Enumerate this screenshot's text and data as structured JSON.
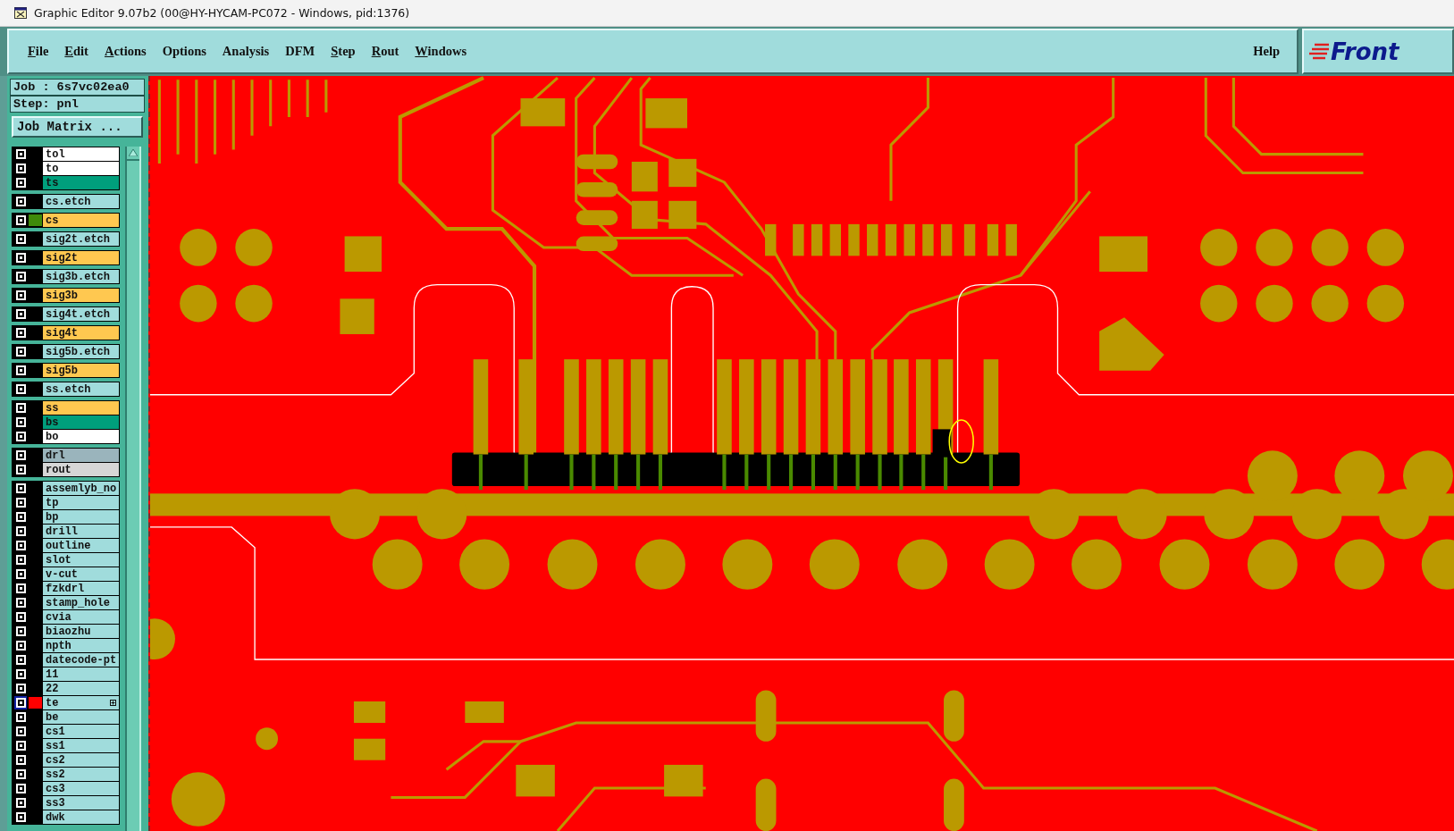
{
  "window": {
    "title": "Graphic Editor 9.07b2 (00@HY-HYCAM-PC072 - Windows, pid:1376)"
  },
  "menu": [
    {
      "label": "File",
      "mnemonic": true
    },
    {
      "label": "Edit",
      "mnemonic": true
    },
    {
      "label": "Actions",
      "mnemonic": true
    },
    {
      "label": "Options",
      "mnemonic": false
    },
    {
      "label": "Analysis",
      "mnemonic": false
    },
    {
      "label": "DFM",
      "mnemonic": false
    },
    {
      "label": "Step",
      "mnemonic": true
    },
    {
      "label": "Rout",
      "mnemonic": true
    },
    {
      "label": "Windows",
      "mnemonic": true
    }
  ],
  "help": "Help",
  "logo": "Front",
  "job": {
    "job": "Job : 6s7vc02ea0",
    "step": "Step: pnl",
    "matrix_button": "Job Matrix ..."
  },
  "layer_groups": [
    {
      "layers": [
        {
          "name": "tol",
          "color": "#ffffff",
          "work": false
        },
        {
          "name": "to",
          "color": "#ffffff",
          "work": false
        },
        {
          "name": "ts",
          "color": "#009f7c",
          "work": false
        }
      ]
    },
    {
      "layers": [
        {
          "name": "cs.etch",
          "color": "#a0dcdc",
          "work": false
        }
      ]
    },
    {
      "layers": [
        {
          "name": "cs",
          "color": "#ffc850",
          "work": false,
          "swatch": {
            "color": "#3f8a0a"
          }
        }
      ]
    },
    {
      "layers": [
        {
          "name": "sig2t.etch",
          "color": "#a0dcdc",
          "work": false
        }
      ]
    },
    {
      "layers": [
        {
          "name": "sig2t",
          "color": "#ffc850",
          "work": false
        }
      ]
    },
    {
      "layers": [
        {
          "name": "sig3b.etch",
          "color": "#a0dcdc",
          "work": false
        }
      ]
    },
    {
      "layers": [
        {
          "name": "sig3b",
          "color": "#ffc850",
          "work": false
        }
      ]
    },
    {
      "layers": [
        {
          "name": "sig4t.etch",
          "color": "#a0dcdc",
          "work": false
        }
      ]
    },
    {
      "layers": [
        {
          "name": "sig4t",
          "color": "#ffc850",
          "work": false
        }
      ]
    },
    {
      "layers": [
        {
          "name": "sig5b.etch",
          "color": "#a0dcdc",
          "work": false
        }
      ]
    },
    {
      "layers": [
        {
          "name": "sig5b",
          "color": "#ffc850",
          "work": false
        }
      ]
    },
    {
      "layers": [
        {
          "name": "ss.etch",
          "color": "#a0dcdc",
          "work": false
        }
      ]
    },
    {
      "layers": [
        {
          "name": "ss",
          "color": "#ffc850",
          "work": false
        },
        {
          "name": "bs",
          "color": "#009f7c",
          "work": false
        },
        {
          "name": "bo",
          "color": "#ffffff",
          "work": false
        }
      ]
    },
    {
      "layers": [
        {
          "name": "drl",
          "color": "#9ab4bc",
          "work": false
        },
        {
          "name": "rout",
          "color": "#d6d6d6",
          "work": false
        }
      ]
    },
    {
      "layers": [
        {
          "name": "assemlyb_no",
          "color": "#a0dcdc",
          "work": false
        },
        {
          "name": "tp",
          "color": "#a0dcdc",
          "work": false
        },
        {
          "name": "bp",
          "color": "#a0dcdc",
          "work": false
        },
        {
          "name": "drill",
          "color": "#a0dcdc",
          "work": false
        },
        {
          "name": "outline",
          "color": "#a0dcdc",
          "work": false
        },
        {
          "name": "slot",
          "color": "#a0dcdc",
          "work": false
        },
        {
          "name": "v-cut",
          "color": "#a0dcdc",
          "work": false
        },
        {
          "name": "fzkdrl",
          "color": "#a0dcdc",
          "work": false
        },
        {
          "name": "stamp_hole",
          "color": "#a0dcdc",
          "work": false
        },
        {
          "name": "cvia",
          "color": "#a0dcdc",
          "work": false
        },
        {
          "name": "biaozhu",
          "color": "#a0dcdc",
          "work": false
        },
        {
          "name": "npth",
          "color": "#a0dcdc",
          "work": false
        },
        {
          "name": "datecode-pt",
          "color": "#a0dcdc",
          "work": false
        },
        {
          "name": "11",
          "color": "#a0dcdc",
          "work": false
        },
        {
          "name": "22",
          "color": "#a0dcdc",
          "work": false
        },
        {
          "name": "te",
          "color": "#a0dcdc",
          "work": true,
          "swatch": {
            "color": "#ff0000"
          }
        },
        {
          "name": "be",
          "color": "#a0dcdc",
          "work": false
        },
        {
          "name": "cs1",
          "color": "#a0dcdc",
          "work": false
        },
        {
          "name": "ss1",
          "color": "#a0dcdc",
          "work": false
        },
        {
          "name": "cs2",
          "color": "#a0dcdc",
          "work": false
        },
        {
          "name": "ss2",
          "color": "#a0dcdc",
          "work": false
        },
        {
          "name": "cs3",
          "color": "#a0dcdc",
          "work": false
        },
        {
          "name": "ss3",
          "color": "#a0dcdc",
          "work": false
        },
        {
          "name": "dwk",
          "color": "#a0dcdc",
          "work": false
        }
      ]
    }
  ]
}
